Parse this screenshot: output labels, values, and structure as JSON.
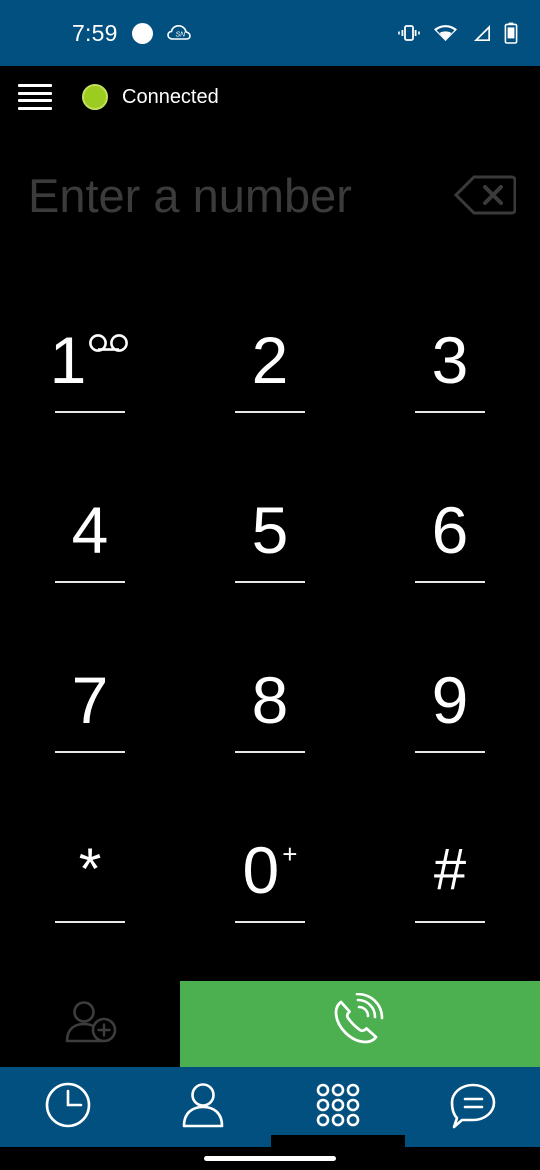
{
  "status_bar": {
    "time": "7:59",
    "left_icons": [
      "white-circle-icon",
      "sn-cloud-icon"
    ],
    "right_icons": [
      "vibrate-icon",
      "wifi-icon",
      "cellular-signal-icon",
      "battery-icon"
    ],
    "background_color": "#02507f"
  },
  "app_bar": {
    "menu_icon": "hamburger-menu-icon",
    "status_dot_color": "#9ccc1f",
    "status_label": "Connected"
  },
  "number_field": {
    "value": "",
    "placeholder": "Enter a number",
    "backspace_icon": "backspace-icon",
    "backspace_enabled": false
  },
  "keypad": {
    "keys": [
      {
        "digit": "1",
        "sup": "",
        "badge": "voicemail-icon"
      },
      {
        "digit": "2",
        "sup": "",
        "badge": ""
      },
      {
        "digit": "3",
        "sup": "",
        "badge": ""
      },
      {
        "digit": "4",
        "sup": "",
        "badge": ""
      },
      {
        "digit": "5",
        "sup": "",
        "badge": ""
      },
      {
        "digit": "6",
        "sup": "",
        "badge": ""
      },
      {
        "digit": "7",
        "sup": "",
        "badge": ""
      },
      {
        "digit": "8",
        "sup": "",
        "badge": ""
      },
      {
        "digit": "9",
        "sup": "",
        "badge": ""
      },
      {
        "digit": "*",
        "sup": "",
        "badge": ""
      },
      {
        "digit": "0",
        "sup": "+",
        "badge": ""
      },
      {
        "digit": "#",
        "sup": "",
        "badge": ""
      }
    ]
  },
  "action_bar": {
    "add_contact_icon": "add-contact-icon",
    "call_icon": "call-icon",
    "call_button_color": "#4caf50"
  },
  "bottom_nav": {
    "items": [
      {
        "name": "recents",
        "icon": "clock-icon",
        "active": false
      },
      {
        "name": "contacts",
        "icon": "person-icon",
        "active": false
      },
      {
        "name": "keypad",
        "icon": "keypad-dots-icon",
        "active": true
      },
      {
        "name": "messages",
        "icon": "chat-bubble-icon",
        "active": false
      }
    ],
    "background_color": "#02507f"
  }
}
